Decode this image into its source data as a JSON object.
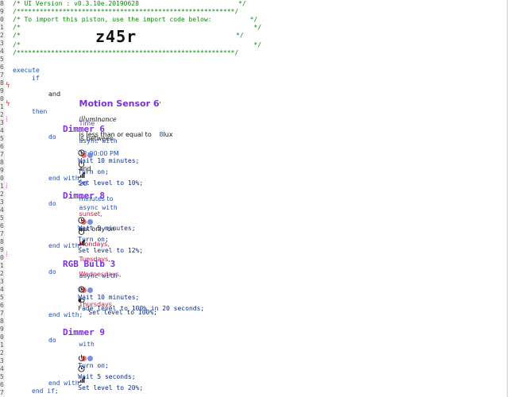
{
  "gutter_numbers": [
    "8",
    "9",
    "0",
    "1",
    "2",
    "3",
    "4",
    "5",
    "6",
    "7",
    "8",
    "9",
    "0",
    "1",
    "2",
    "3",
    "4",
    "5",
    "6",
    "7",
    "8",
    "9",
    "0",
    "1",
    "2",
    "3",
    "4",
    "5",
    "6",
    "7",
    "8",
    "9",
    "0",
    "1",
    "2",
    "3",
    "4",
    "5",
    "6",
    "7",
    "8",
    "9",
    "0",
    "1",
    "2",
    "3",
    "4",
    "5",
    "6",
    "7"
  ],
  "header": {
    "version_line": "/* UI Version : v0.3.10e.20190628                          */",
    "stars": "/*********************************************************/",
    "import_line": "/* To import this piston, use the import code below:          */",
    "blank_line": "/*                                                             */",
    "code_prefix": "/*",
    "import_code": "z45r",
    "code_suffix": "*/"
  },
  "blocks": {
    "execute": "execute",
    "if": "if",
    "then": "then",
    "and": "and",
    "async_with": "async with",
    "with": "with",
    "do": "do",
    "end_with": "end with;",
    "end_if": "end if;"
  },
  "condition1": {
    "device": "Motion Sensor 6",
    "tick": "'",
    "attribute": "illuminance",
    "op": "is less than or equal to",
    "value": "8",
    "unit": "lux"
  },
  "condition2": {
    "subject": "Time",
    "op": "is between",
    "t1": "12:00:00 PM",
    "and": "and",
    "mins": "20",
    "minutes_to": "minutes to",
    "sunset": "sunset,",
    "only_on": "but only on",
    "d1": "Mondays,",
    "d2": "Tuesdays,",
    "d3": "Wednesdays,",
    "or": "or",
    "d4": "Thursdays"
  },
  "group1": {
    "device": "Dimmer 6",
    "s1": "Wait 10 minutes;",
    "s2": "Turn on;",
    "s3": "Set level to 10%;"
  },
  "group2": {
    "device": "Dimmer 8",
    "s1": "Wait 5 minutes;",
    "s2": "Turn on;",
    "s3": "Set level to 12%;"
  },
  "group3": {
    "device": "RGB Bulb 3",
    "s1": "Wait 10 minutes;",
    "s2": "Fade level to 100% in 20 seconds;",
    "s3": "Set level to 100%;"
  },
  "group4": {
    "device": "Dimmer 9",
    "s1": "Turn on;",
    "s2": "Wait 5 seconds;",
    "s3": "Set level to 20%;"
  }
}
